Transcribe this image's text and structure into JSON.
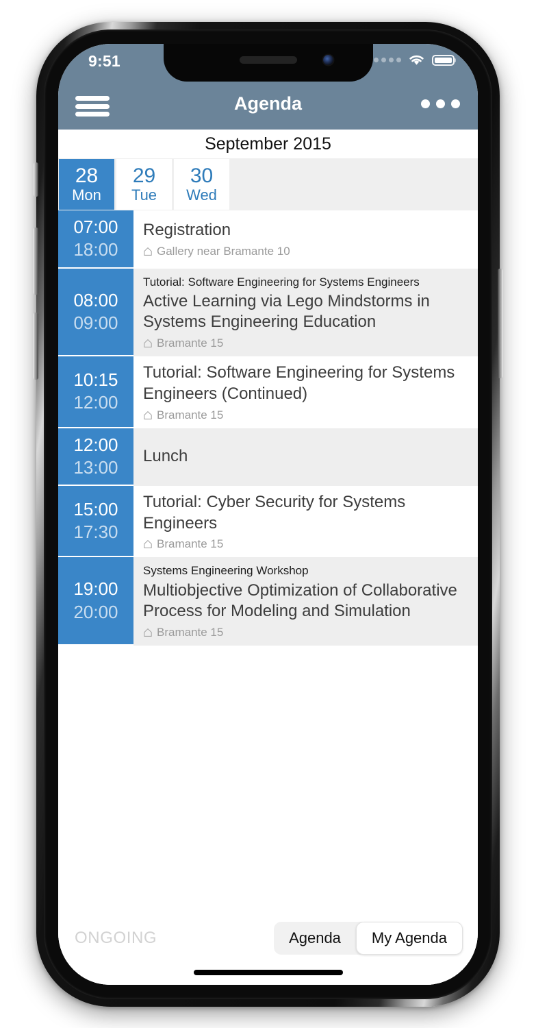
{
  "status_bar": {
    "time": "9:51",
    "signal_icon": "signal-dots-icon",
    "wifi_icon": "wifi-icon",
    "battery_icon": "battery-full-icon"
  },
  "header": {
    "title": "Agenda",
    "menu_icon": "hamburger-menu-icon",
    "overflow_icon": "overflow-dots-icon"
  },
  "calendar": {
    "month_label": "September 2015",
    "days": [
      {
        "number": "28",
        "weekday": "Mon",
        "selected": true
      },
      {
        "number": "29",
        "weekday": "Tue",
        "selected": false
      },
      {
        "number": "30",
        "weekday": "Wed",
        "selected": false
      }
    ]
  },
  "agenda": {
    "events": [
      {
        "start": "07:00",
        "end": "18:00",
        "subtitle": "",
        "title": "Registration",
        "location": "Gallery near Bramante 10"
      },
      {
        "start": "08:00",
        "end": "09:00",
        "subtitle": "Tutorial: Software Engineering for Systems Engineers",
        "title": "Active Learning via Lego Mindstorms in Systems Engineering Education",
        "location": "Bramante 15"
      },
      {
        "start": "10:15",
        "end": "12:00",
        "subtitle": "",
        "title": "Tutorial: Software Engineering for Systems Engineers (Continued)",
        "location": "Bramante 15"
      },
      {
        "start": "12:00",
        "end": "13:00",
        "subtitle": "",
        "title": "Lunch",
        "location": ""
      },
      {
        "start": "15:00",
        "end": "17:30",
        "subtitle": "",
        "title": "Tutorial: Cyber Security for Systems Engineers",
        "location": "Bramante 15"
      },
      {
        "start": "19:00",
        "end": "20:00",
        "subtitle": "Systems Engineering Workshop",
        "title": "Multiobjective Optimization of Collaborative Process for Modeling and Simulation",
        "location": "Bramante 15"
      }
    ],
    "location_icon": "location-home-icon"
  },
  "bottom_bar": {
    "ongoing_label": "ONGOING",
    "segments": [
      {
        "label": "Agenda",
        "selected": false
      },
      {
        "label": "My Agenda",
        "selected": true
      }
    ]
  },
  "colors": {
    "header_bg": "#6b8499",
    "accent_blue": "#3a86c8",
    "date_text_blue": "#2f7cba",
    "row_alt_bg": "#eeeeee",
    "title_text": "#3d3d3d",
    "location_text": "#9a9a9a",
    "ongoing_text": "#d2d2d2"
  }
}
